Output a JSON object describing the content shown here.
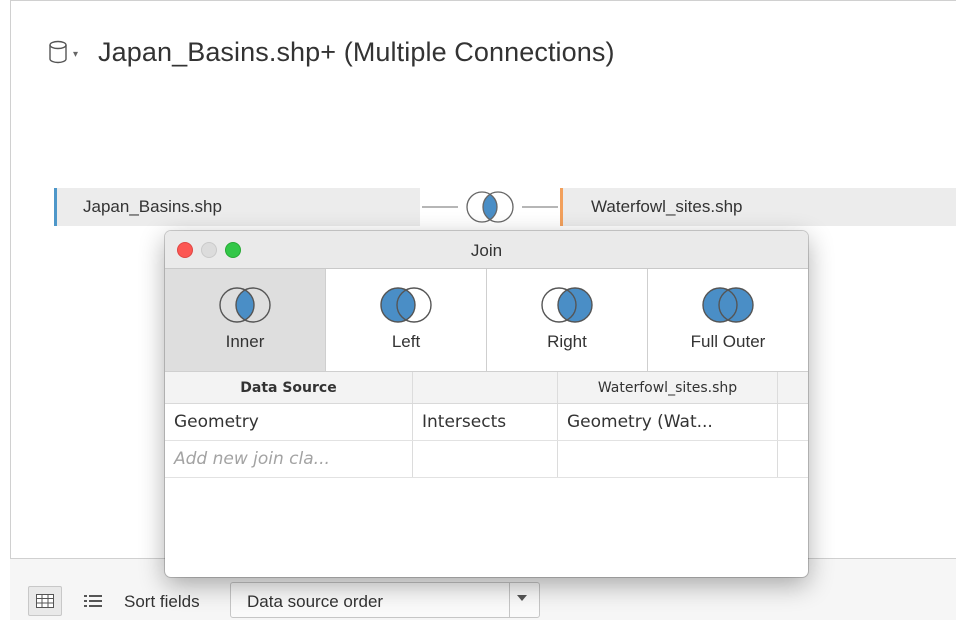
{
  "datasource": {
    "title": "Japan_Basins.shp+ (Multiple Connections)",
    "icon": "database-icon"
  },
  "canvas": {
    "left_table": "Japan_Basins.shp",
    "right_table": "Waterfowl_sites.shp",
    "left_color": "#4e97c9",
    "right_color": "#f2a05c"
  },
  "join_dialog": {
    "title": "Join",
    "join_types": [
      {
        "label": "Inner",
        "selected": true
      },
      {
        "label": "Left",
        "selected": false
      },
      {
        "label": "Right",
        "selected": false
      },
      {
        "label": "Full Outer",
        "selected": false
      }
    ],
    "clause_header": {
      "left": "Data Source",
      "operator": "",
      "right": "Waterfowl_sites.shp"
    },
    "clauses": [
      {
        "left": "Geometry",
        "operator": "Intersects",
        "right": "Geometry (Wat..."
      }
    ],
    "add_clause_placeholder": "Add new join cla...",
    "venn_fill_color": "#4a8ec6"
  },
  "bottom_bar": {
    "sort_label": "Sort fields",
    "sort_value": "Data source order"
  }
}
